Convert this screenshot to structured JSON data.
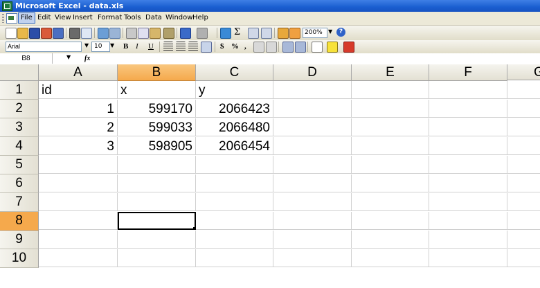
{
  "window": {
    "title": "Microsoft Excel - data.xls"
  },
  "menu": [
    "File",
    "Edit",
    "View",
    "Insert",
    "Format",
    "Tools",
    "Data",
    "Window",
    "Help"
  ],
  "toolbar": {
    "zoom": "200%",
    "help_label": "?"
  },
  "format_toolbar": {
    "font": "Arial",
    "size": "10",
    "bold": "B",
    "italic": "I",
    "underline": "U",
    "currency": "$",
    "percent": "%",
    "comma": ","
  },
  "formula_bar": {
    "cell_ref": "B8",
    "fx": "fx",
    "content": ""
  },
  "sheet": {
    "columns": [
      "A",
      "B",
      "C",
      "D",
      "E",
      "F",
      "G"
    ],
    "selected_column": "B",
    "selected_row": "8",
    "active_cell": "B8",
    "rows": [
      {
        "num": "1",
        "A": "id",
        "B": "x",
        "C": "y"
      },
      {
        "num": "2",
        "A": "1",
        "B": "599170",
        "C": "2066423"
      },
      {
        "num": "3",
        "A": "2",
        "B": "599033",
        "C": "2066480"
      },
      {
        "num": "4",
        "A": "3",
        "B": "598905",
        "C": "2066454"
      },
      {
        "num": "5",
        "A": "",
        "B": "",
        "C": ""
      },
      {
        "num": "6",
        "A": "",
        "B": "",
        "C": ""
      },
      {
        "num": "7",
        "A": "",
        "B": "",
        "C": ""
      },
      {
        "num": "8",
        "A": "",
        "B": "",
        "C": ""
      },
      {
        "num": "9",
        "A": "",
        "B": "",
        "C": ""
      },
      {
        "num": "10",
        "A": "",
        "B": "",
        "C": ""
      }
    ]
  },
  "colors": {
    "title_bar": "#1a5fd0",
    "selection_header": "#f5a94c",
    "workbook_icon": "#1f7a3d"
  }
}
